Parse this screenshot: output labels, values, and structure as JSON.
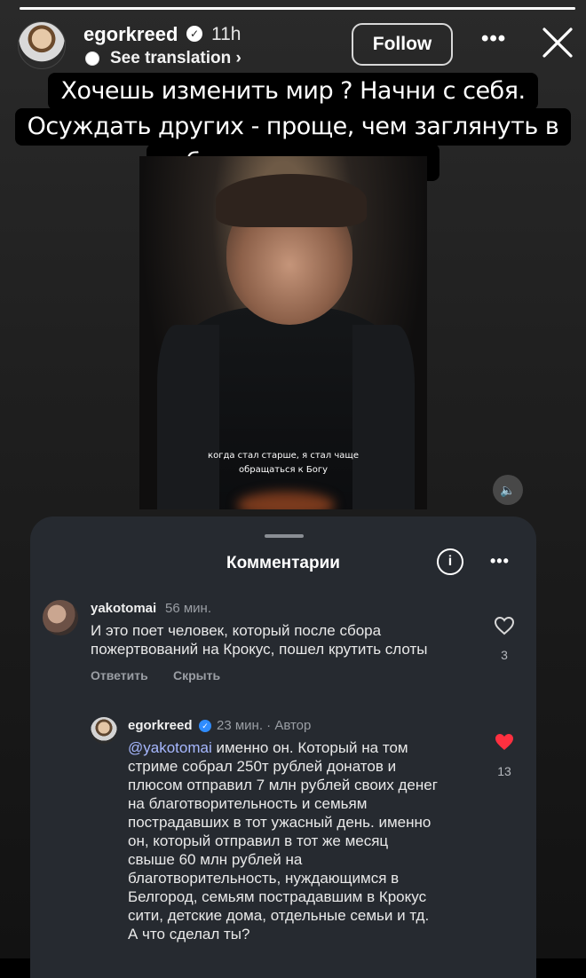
{
  "story": {
    "progress": 1.0,
    "username": "egorkreed",
    "time": "11h",
    "see_translation": "See translation",
    "follow_label": "Follow",
    "caption": [
      "Хочешь изменить мир ? Начни с себя.",
      "Осуждать других - проще, чем заглянуть в",
      "собственное зеркало."
    ],
    "video_subtitle": [
      "когда стал старше, я стал чаще",
      "обращаться к Богу"
    ]
  },
  "comments": {
    "title": "Комментарии",
    "items": [
      {
        "user": "yakotomai",
        "time": "56 мин.",
        "text": [
          "И это поет человек, который после сбора",
          "пожертвований на Крокус, пошел крутить слоты"
        ],
        "likes": "3",
        "reply_label": "Ответить",
        "hide_label": "Скрыть"
      },
      {
        "user": "egorkreed",
        "time": "23 мин. · Автор",
        "mention": "@yakotomai",
        "text_first": " именно он. Который на том",
        "text": [
          "стриме собрал 250т рублей донатов и",
          "плюсом отправил 7 млн рублей своих денег",
          "на благотворительность и семьям",
          "пострадавших в тот ужасный день. именно",
          "он, который отправил в тот же месяц",
          "свыше 60 млн рублей на",
          "благотворительность, нуждающимся в",
          "Белгород, семьям пострадавшим в Крокус",
          "сити, детские дома, отдельные семьи и тд.",
          "А что сделал ты?"
        ],
        "likes": "13"
      }
    ]
  },
  "colors": {
    "liked_heart": "#ff3040",
    "mention": "#a7b8ff",
    "sheet_bg": "#262a30"
  }
}
